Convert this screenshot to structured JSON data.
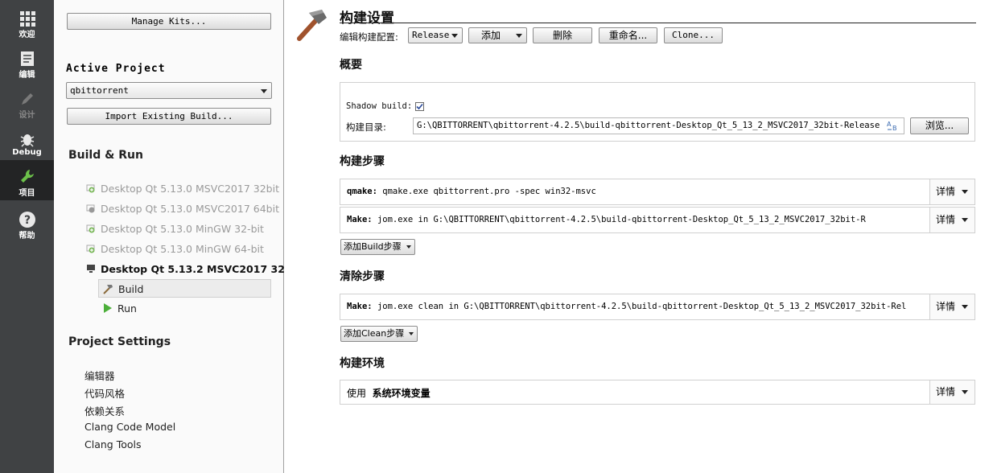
{
  "modebar": {
    "items": [
      {
        "label": "欢迎",
        "icon": "grid-icon"
      },
      {
        "label": "编辑",
        "icon": "document-icon"
      },
      {
        "label": "设计",
        "icon": "pencil-icon"
      },
      {
        "label": "Debug",
        "icon": "bug-icon"
      },
      {
        "label": "项目",
        "icon": "wrench-icon"
      },
      {
        "label": "帮助",
        "icon": "help-icon"
      }
    ],
    "active": "项目"
  },
  "sidebar": {
    "manage_kits": "Manage Kits...",
    "active_project_heading": "Active Project",
    "project_select": "qbittorrent",
    "import_build": "Import Existing Build...",
    "build_run_heading": "Build & Run",
    "kits": [
      "Desktop Qt 5.13.0 MSVC2017 32bit",
      "Desktop Qt 5.13.0 MSVC2017 64bit",
      "Desktop Qt 5.13.0 MinGW 32-bit",
      "Desktop Qt 5.13.0 MinGW 64-bit",
      "Desktop Qt 5.13.2 MSVC2017 32..."
    ],
    "build_item": "Build",
    "run_item": "Run",
    "project_settings_heading": "Project Settings",
    "settings": [
      "编辑器",
      "代码风格",
      "依赖关系",
      "Clang Code Model",
      "Clang Tools"
    ]
  },
  "main": {
    "title": "构建设置",
    "edit_config_label": "编辑构建配置:",
    "config_select": "Release",
    "add_button": "添加",
    "delete_button": "删除",
    "rename_button": "重命名...",
    "clone_button": "Clone...",
    "overview_heading": "概要",
    "shadow_build_label": "Shadow build:",
    "shadow_build_checked": true,
    "build_dir_label": "构建目录:",
    "build_dir_value": "G:\\QBITTORRENT\\qbittorrent-4.2.5\\build-qbittorrent-Desktop_Qt_5_13_2_MSVC2017_32bit-Release",
    "browse_button": "浏览...",
    "build_steps_heading": "构建步骤",
    "build_steps": [
      {
        "tool": "qmake:",
        "command": "qmake.exe qbittorrent.pro -spec win32-msvc"
      },
      {
        "tool": "Make:",
        "command": "jom.exe in G:\\QBITTORRENT\\qbittorrent-4.2.5\\build-qbittorrent-Desktop_Qt_5_13_2_MSVC2017_32bit-R"
      }
    ],
    "details_label": "详情",
    "add_build_step": "添加Build步骤",
    "clean_steps_heading": "清除步骤",
    "clean_steps": [
      {
        "tool": "Make:",
        "command": "jom.exe clean in G:\\QBITTORRENT\\qbittorrent-4.2.5\\build-qbittorrent-Desktop_Qt_5_13_2_MSVC2017_32bit-Rel"
      }
    ],
    "add_clean_step": "添加Clean步骤",
    "env_heading": "构建环境",
    "env_use": "使用",
    "env_value": "系统环境变量"
  }
}
